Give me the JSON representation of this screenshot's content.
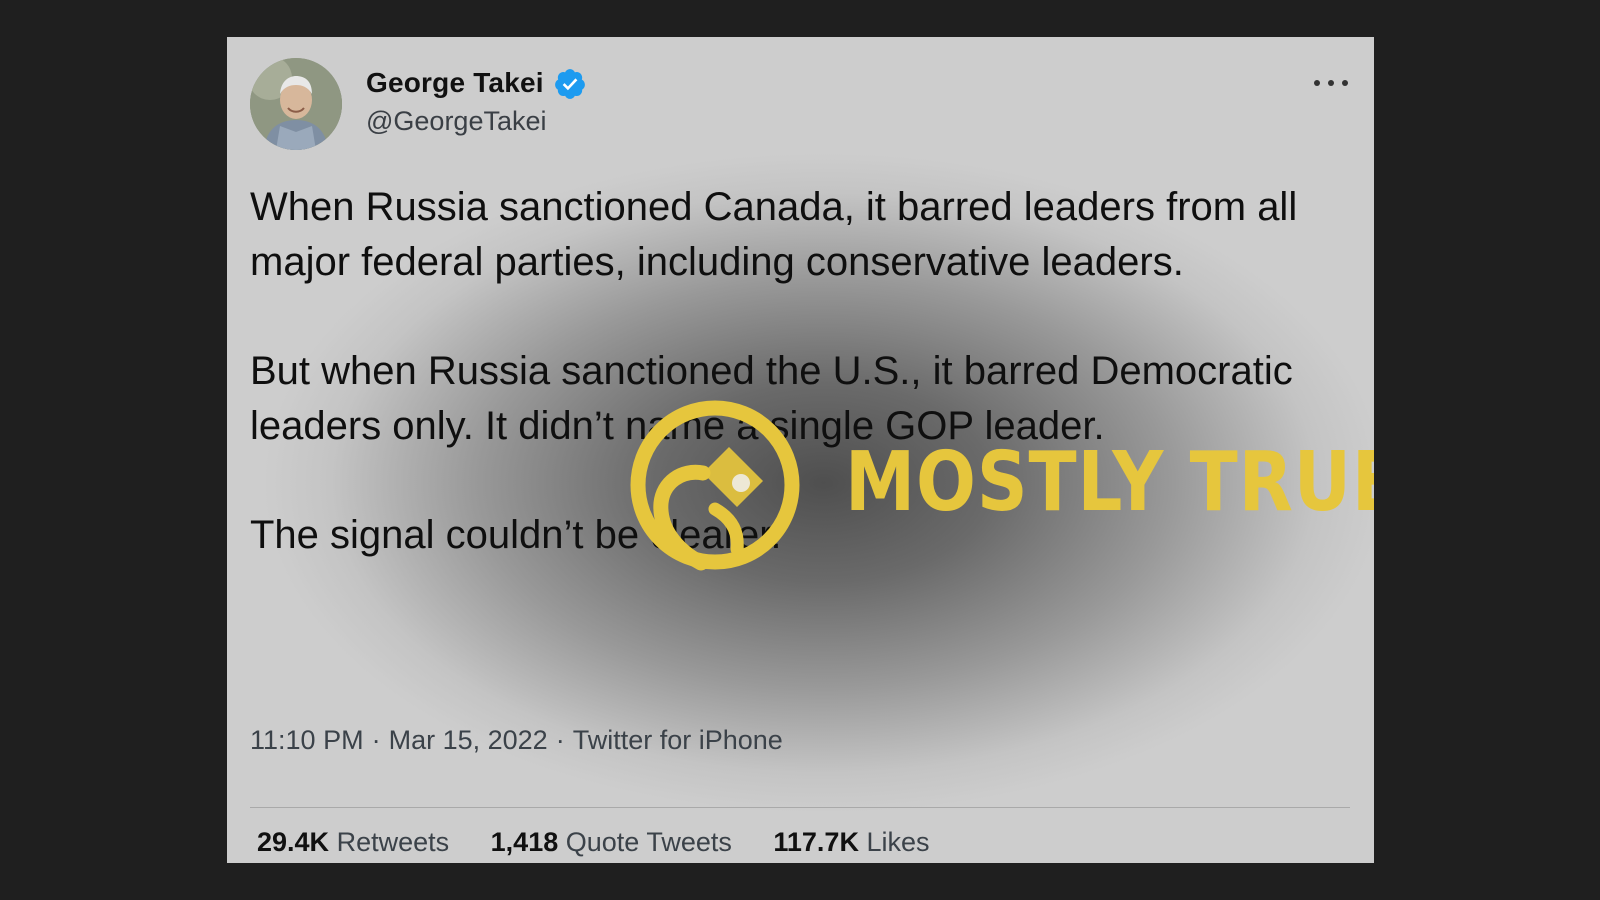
{
  "tweet": {
    "author_name": "George Takei",
    "author_handle": "@GeorgeTakei",
    "verified_icon": "verified-badge-icon",
    "more_icon": "more-horizontal-icon",
    "paragraphs": [
      "When Russia sanctioned Canada, it barred leaders from all major federal parties, including conservative leaders.",
      "But when Russia sanctioned the U.S., it barred Democratic leaders only. It didn’t name a single GOP leader.",
      "The signal couldn’t be clearer."
    ],
    "time": "11:10 PM",
    "date": "Mar 15, 2022",
    "source": "Twitter for iPhone",
    "meta_separator": "·",
    "stats": [
      {
        "count": "29.4K",
        "label": "Retweets"
      },
      {
        "count": "1,418",
        "label": "Quote Tweets"
      },
      {
        "count": "117.7K",
        "label": "Likes"
      }
    ]
  },
  "rating": {
    "label": "MOSTLY TRUE",
    "color": "#e6c63d",
    "icon": "truth-meter-logo-icon"
  },
  "colors": {
    "background": "#1f1f1f",
    "verified": "#1d9bf0",
    "text": "#0f0f0f",
    "muted_text": "#3b4249"
  }
}
